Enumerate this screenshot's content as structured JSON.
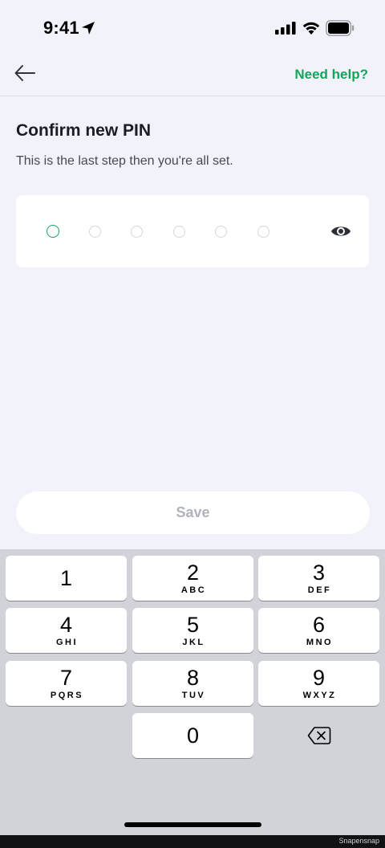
{
  "status_bar": {
    "time": "9:41",
    "icons": [
      "location-arrow-icon",
      "cellular-signal-icon",
      "wifi-icon",
      "battery-icon"
    ]
  },
  "header": {
    "back_icon": "arrow-left-icon",
    "help_label": "Need help?"
  },
  "content": {
    "title": "Confirm new PIN",
    "subtitle": "This is the last step then you're all set."
  },
  "pin": {
    "length": 6,
    "filled": 0,
    "visibility_icon": "eye-icon"
  },
  "save_label": "Save",
  "keypad": {
    "keys": [
      {
        "digit": "1",
        "letters": ""
      },
      {
        "digit": "2",
        "letters": "ABC"
      },
      {
        "digit": "3",
        "letters": "DEF"
      },
      {
        "digit": "4",
        "letters": "GHI"
      },
      {
        "digit": "5",
        "letters": "JKL"
      },
      {
        "digit": "6",
        "letters": "MNO"
      },
      {
        "digit": "7",
        "letters": "PQRS"
      },
      {
        "digit": "8",
        "letters": "TUV"
      },
      {
        "digit": "9",
        "letters": "WXYZ"
      },
      {
        "digit": "0",
        "letters": ""
      }
    ],
    "delete_icon": "backspace-icon"
  },
  "watermark": "Snapensnap",
  "colors": {
    "accent": "#14a45a",
    "background": "#f1f2fa",
    "keypad_bg": "#d1d3d9",
    "disabled_text": "#b0b2bc"
  }
}
